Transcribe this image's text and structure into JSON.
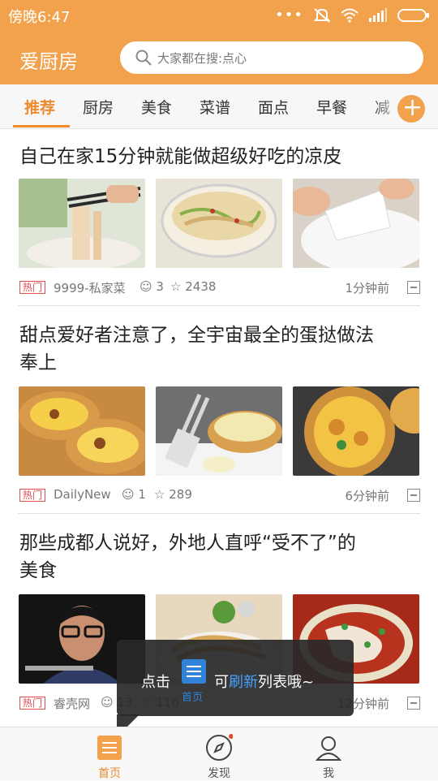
{
  "status_bar": {
    "time": "傍晚6:47"
  },
  "app_bar": {
    "title": "爱厨房",
    "search_placeholder": "大家都在搜:点心"
  },
  "tabs": [
    {
      "label": "推荐",
      "active": true
    },
    {
      "label": "厨房"
    },
    {
      "label": "美食"
    },
    {
      "label": "菜谱"
    },
    {
      "label": "面点"
    },
    {
      "label": "早餐"
    },
    {
      "label": "减"
    }
  ],
  "articles": [
    {
      "title_lines": [
        "自己在家15分钟就能做超级好吃的凉皮"
      ],
      "badge": "热门",
      "source": "9999-私家菜",
      "comments": "3",
      "stars": "2438",
      "time": "1分钟前"
    },
    {
      "title_lines": [
        "甜点爱好者注意了，全宇宙最全的蛋挞做法",
        "奉上"
      ],
      "badge": "热门",
      "source": "DailyNew",
      "comments": "1",
      "stars": "289",
      "time": "6分钟前"
    },
    {
      "title_lines": [
        "那些成都人说好，外地人直呼“受不了”的",
        "美食"
      ],
      "badge": "热门",
      "source": "睿壳网",
      "comments": "13",
      "stars": "116",
      "time": "12分钟前"
    }
  ],
  "tooltip": {
    "prefix": "点击",
    "icon_label": "首页",
    "text_before": "可",
    "highlight": "刷新",
    "text_after": "列表哦~"
  },
  "bottom_nav": [
    {
      "label": "首页",
      "active": true
    },
    {
      "label": "发现"
    },
    {
      "label": "我"
    }
  ],
  "colors": {
    "brand": "#f2a24c",
    "accent": "#f08a2f",
    "link": "#47a1ff"
  }
}
